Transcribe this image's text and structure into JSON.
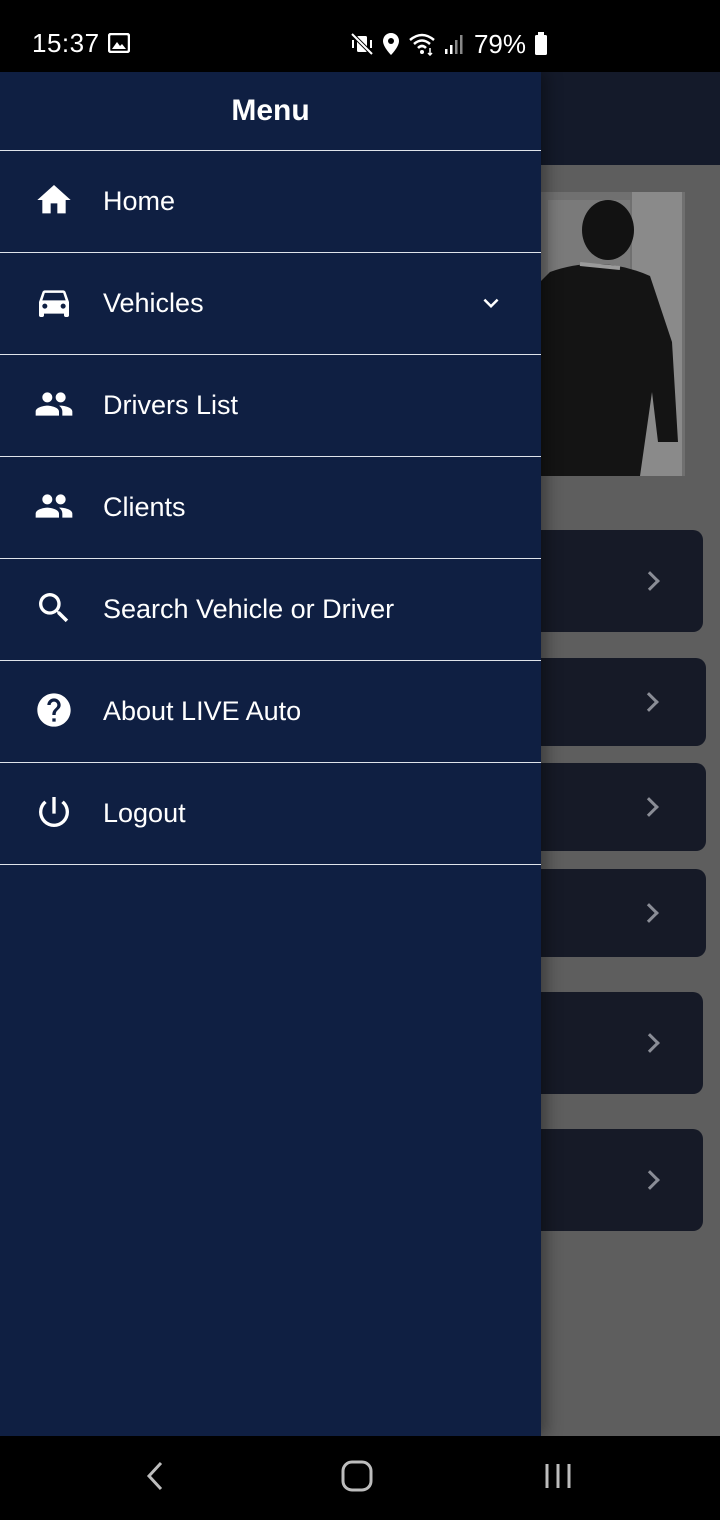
{
  "status_bar": {
    "time": "15:37",
    "battery_percent": "79%",
    "icons": [
      "gallery-icon",
      "vibrate-mute-icon",
      "location-icon",
      "wifi-icon",
      "signal-icon",
      "battery-icon"
    ]
  },
  "drawer": {
    "title": "Menu",
    "items": [
      {
        "label": "Home",
        "icon": "home-icon"
      },
      {
        "label": "Vehicles",
        "icon": "car-icon",
        "expandable": true
      },
      {
        "label": "Drivers List",
        "icon": "people-icon"
      },
      {
        "label": "Clients",
        "icon": "people-icon"
      },
      {
        "label": "Search Vehicle or Driver",
        "icon": "search-icon"
      },
      {
        "label": "About LIVE Auto",
        "icon": "help-icon"
      },
      {
        "label": "Logout",
        "icon": "power-icon"
      }
    ]
  },
  "nav_bar": {
    "buttons": [
      "back-icon",
      "home-circle-icon",
      "recents-icon"
    ]
  },
  "colors": {
    "drawer_bg": "#0f1f42",
    "divider": "#dfe3ea",
    "scrim_bg": "#5e5e5e",
    "bg_card": "#161a27"
  }
}
